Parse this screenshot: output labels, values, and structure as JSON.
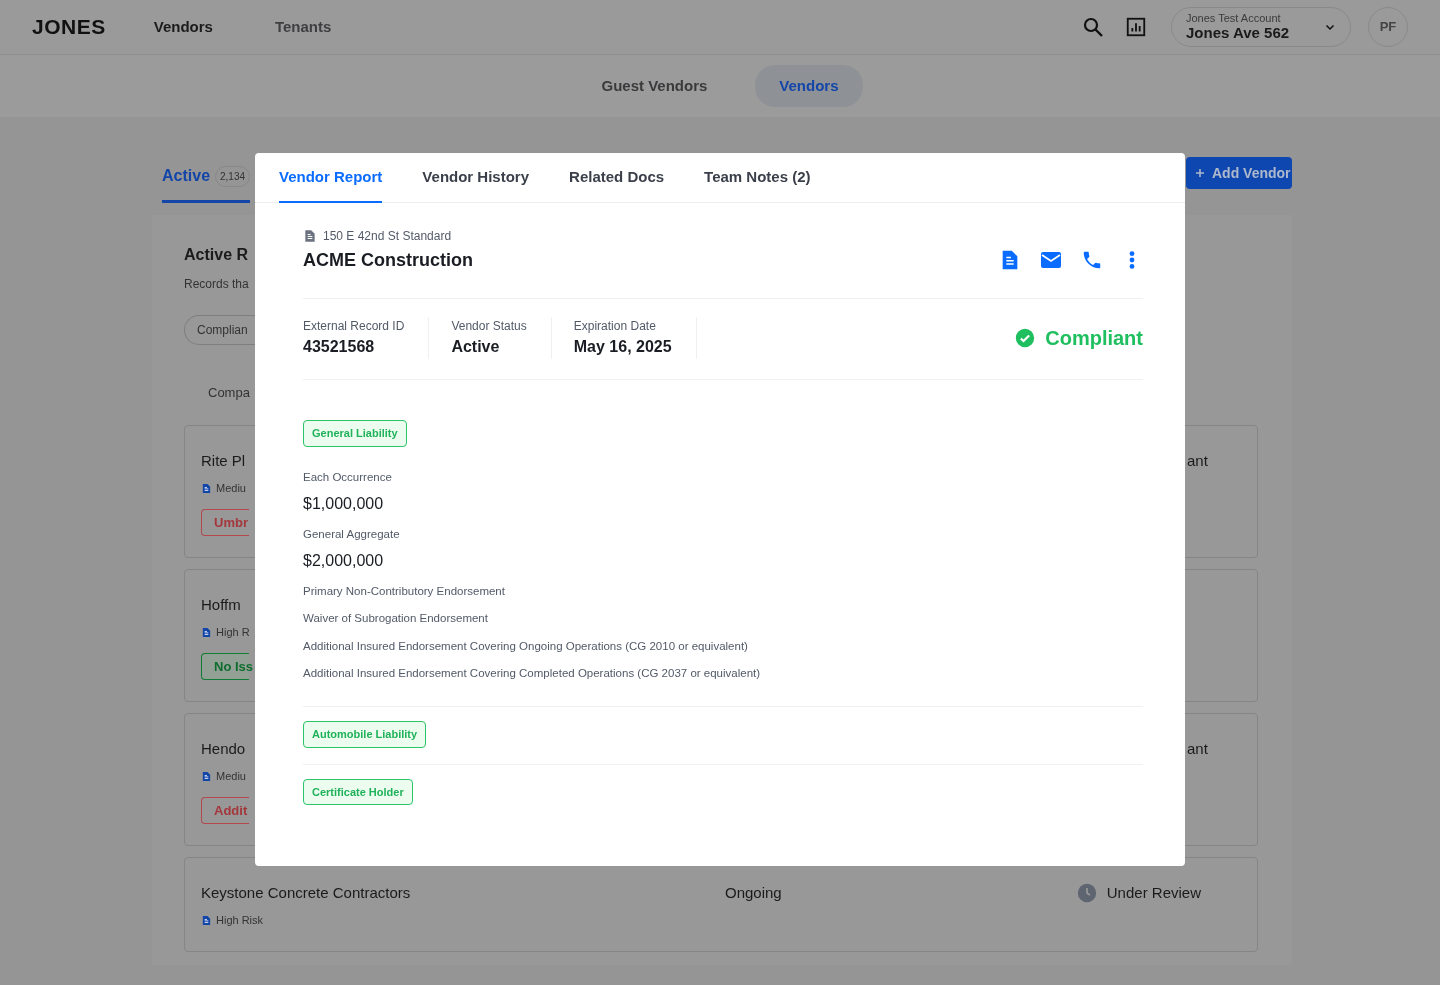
{
  "topnav": {
    "logo": "JONES",
    "links": [
      {
        "label": "Vendors",
        "selected": true
      },
      {
        "label": "Tenants",
        "selected": false
      }
    ],
    "account": {
      "caption": "Jones Test Account",
      "name": "Jones Ave 562"
    },
    "avatar": "PF"
  },
  "subnav": {
    "tabs": [
      {
        "label": "Guest Vendors",
        "selected": false
      },
      {
        "label": "Vendors",
        "selected": true
      }
    ]
  },
  "page": {
    "tabs": [
      {
        "label": "Active",
        "count": "2,134",
        "selected": true
      }
    ],
    "add_button": "Add Vendor",
    "heading": "Active R",
    "subheading": "Records tha",
    "filter": "Complian",
    "column_header": "Compa",
    "rows": [
      {
        "name": "Rite Pl",
        "risk": "Mediu",
        "tag": {
          "label": "Umbr",
          "kind": "issue"
        },
        "status": "ant"
      },
      {
        "name": "Hoffm",
        "risk": "High R",
        "tag": {
          "label": "No Iss",
          "kind": "ok"
        }
      },
      {
        "name": "Hendo",
        "risk": "Mediu",
        "tag": {
          "label": "Addit",
          "kind": "issue"
        },
        "status": "ant"
      },
      {
        "name": "Keystone Concrete Contractors",
        "risk": "High Risk",
        "period": "Ongoing",
        "status": "Under Review",
        "pending": true
      }
    ]
  },
  "modal": {
    "tabs": [
      {
        "label": "Vendor Report",
        "selected": true
      },
      {
        "label": "Vendor History",
        "selected": false
      },
      {
        "label": "Related Docs",
        "selected": false
      },
      {
        "label": "Team Notes (2)",
        "selected": false
      }
    ],
    "vendor": {
      "template": "150 E 42nd St Standard",
      "name": "ACME Construction"
    },
    "fields": [
      {
        "label": "External Record ID",
        "value": "43521568"
      },
      {
        "label": "Vendor Status",
        "value": "Active"
      },
      {
        "label": "Expiration Date",
        "value": "May 16, 2025"
      }
    ],
    "compliance": {
      "status": "Compliant",
      "compliant": true
    },
    "sections": [
      {
        "title": "General Liability",
        "items": [
          {
            "kind": "label",
            "text": "Each Occurrence"
          },
          {
            "kind": "amount",
            "text": "$1,000,000"
          },
          {
            "kind": "label",
            "text": "General Aggregate"
          },
          {
            "kind": "amount",
            "text": "$2,000,000"
          },
          {
            "kind": "label",
            "text": "Primary Non-Contributory Endorsement"
          },
          {
            "kind": "label",
            "text": "Waiver of Subrogation Endorsement"
          },
          {
            "kind": "label",
            "text": "Additional Insured Endorsement Covering Ongoing Operations (CG 2010 or equivalent)"
          },
          {
            "kind": "label",
            "text": "Additional Insured Endorsement Covering Completed Operations (CG 2037 or equivalent)"
          }
        ]
      },
      {
        "title": "Automobile Liability"
      },
      {
        "title": "Certificate Holder"
      }
    ]
  }
}
